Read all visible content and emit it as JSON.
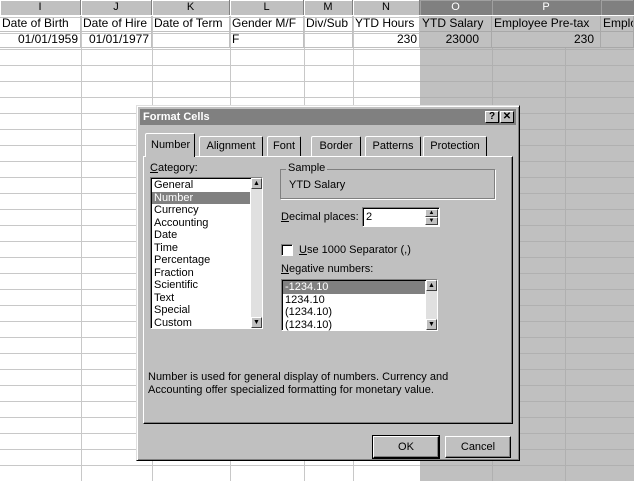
{
  "sheet": {
    "columns": [
      {
        "letter": "I",
        "header": "Date of Birth",
        "row1": "01/01/1959"
      },
      {
        "letter": "J",
        "header": "Date of Hire",
        "row1": "01/01/1977"
      },
      {
        "letter": "K",
        "header": "Date of Term",
        "row1": ""
      },
      {
        "letter": "L",
        "header": "Gender M/F",
        "row1": "F"
      },
      {
        "letter": "M",
        "header": "Div/Sub",
        "row1": ""
      },
      {
        "letter": "N",
        "header": "YTD Hours",
        "row1": "230"
      },
      {
        "letter": "O",
        "header": "YTD Salary",
        "row1": "23000"
      },
      {
        "letter": "P",
        "header": "Employee Pre-tax",
        "row1": "230"
      },
      {
        "letter": "",
        "header": "Emplo",
        "row1": ""
      }
    ]
  },
  "dialog": {
    "title": "Format Cells",
    "help_glyph": "?",
    "close_glyph": "✕",
    "tabs": [
      "Number",
      "Alignment",
      "Font",
      "Border",
      "Patterns",
      "Protection"
    ],
    "active_tab": "Number",
    "category_label": "Category:",
    "categories": [
      "General",
      "Number",
      "Currency",
      "Accounting",
      "Date",
      "Time",
      "Percentage",
      "Fraction",
      "Scientific",
      "Text",
      "Special",
      "Custom"
    ],
    "selected_category": "Number",
    "sample_label": "Sample",
    "sample_value": "YTD Salary",
    "decimal_places_label": "Decimal places:",
    "decimal_places_value": "2",
    "separator_label": "Use 1000 Separator (,)",
    "separator_checked": false,
    "negative_numbers_label": "Negative numbers:",
    "negative_numbers": [
      "-1234.10",
      "1234.10",
      "(1234.10)",
      "(1234.10)"
    ],
    "selected_negative": "-1234.10",
    "description": "Number is used for general display of numbers.  Currency and Accounting offer specialized formatting for monetary value.",
    "ok_label": "OK",
    "cancel_label": "Cancel"
  }
}
